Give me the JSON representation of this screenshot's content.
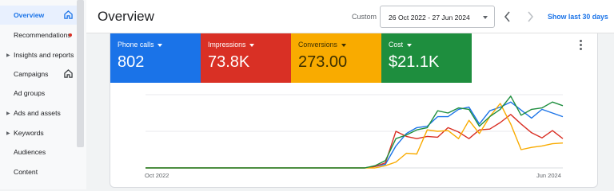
{
  "sidebar": {
    "items": [
      {
        "label": "Overview",
        "active": true,
        "icon": "home-icon"
      },
      {
        "label": "Recommendations",
        "badge": "notification-dot"
      },
      {
        "label": "Insights and reports",
        "expandable": true
      },
      {
        "label": "Campaigns",
        "icon": "home-icon"
      },
      {
        "label": "Ad groups"
      },
      {
        "label": "Ads and assets",
        "expandable": true
      },
      {
        "label": "Keywords",
        "expandable": true
      },
      {
        "label": "Audiences"
      },
      {
        "label": "Content"
      }
    ]
  },
  "header": {
    "title": "Overview",
    "custom_label": "Custom",
    "date_range": "26 Oct 2022 - 27 Jun 2024",
    "show_last": "Show last 30 days"
  },
  "metrics": [
    {
      "label": "Phone calls",
      "value": "802",
      "color": "#1a73e8"
    },
    {
      "label": "Impressions",
      "value": "73.8K",
      "color": "#d93025"
    },
    {
      "label": "Conversions",
      "value": "273.00",
      "color": "#f9ab00"
    },
    {
      "label": "Cost",
      "value": "$21.1K",
      "color": "#1e8e3e"
    }
  ],
  "chart_data": {
    "type": "line",
    "x_labels": [
      "Oct 2022",
      "Jun 2024"
    ],
    "grid": true,
    "legend": "none",
    "series": [
      {
        "metric": "Phone calls",
        "color": "#1a73e8",
        "values": [
          0,
          0,
          0,
          0,
          0,
          0,
          0,
          0,
          0,
          0,
          0,
          0,
          0,
          0,
          0,
          0,
          0,
          0,
          0,
          0,
          0,
          0,
          0.02,
          0.05,
          0.3,
          0.47,
          0.55,
          0.57,
          0.7,
          0.7,
          0.8,
          0.83,
          0.6,
          0.78,
          0.83,
          0.9,
          0.79,
          0.68,
          0.8,
          0.75,
          0.7
        ]
      },
      {
        "metric": "Impressions",
        "color": "#d93025",
        "values": [
          0,
          0,
          0,
          0,
          0,
          0,
          0,
          0,
          0,
          0,
          0,
          0,
          0,
          0,
          0,
          0,
          0,
          0,
          0,
          0,
          0,
          0,
          0.02,
          0.07,
          0.5,
          0.43,
          0.4,
          0.43,
          0.42,
          0.55,
          0.49,
          0.4,
          0.52,
          0.53,
          0.62,
          0.73,
          0.6,
          0.48,
          0.41,
          0.51,
          0.4
        ]
      },
      {
        "metric": "Conversions",
        "color": "#f9ab00",
        "values": [
          0,
          0,
          0,
          0,
          0,
          0,
          0,
          0,
          0,
          0,
          0,
          0,
          0,
          0,
          0,
          0,
          0,
          0,
          0,
          0,
          0,
          0,
          0,
          0.03,
          0.08,
          0.2,
          0.19,
          0.52,
          0.5,
          0.51,
          0.4,
          0.65,
          0.47,
          0.7,
          0.88,
          0.6,
          0.25,
          0.28,
          0.3,
          0.33,
          0.34
        ]
      },
      {
        "metric": "Cost",
        "color": "#1e8e3e",
        "values": [
          0,
          0,
          0,
          0,
          0,
          0,
          0,
          0,
          0,
          0,
          0,
          0,
          0,
          0,
          0,
          0,
          0,
          0,
          0,
          0,
          0,
          0,
          0.03,
          0.1,
          0.4,
          0.45,
          0.52,
          0.55,
          0.78,
          0.75,
          0.82,
          0.8,
          0.57,
          0.7,
          0.8,
          0.98,
          0.72,
          0.8,
          0.82,
          0.9,
          0.85
        ]
      }
    ]
  }
}
